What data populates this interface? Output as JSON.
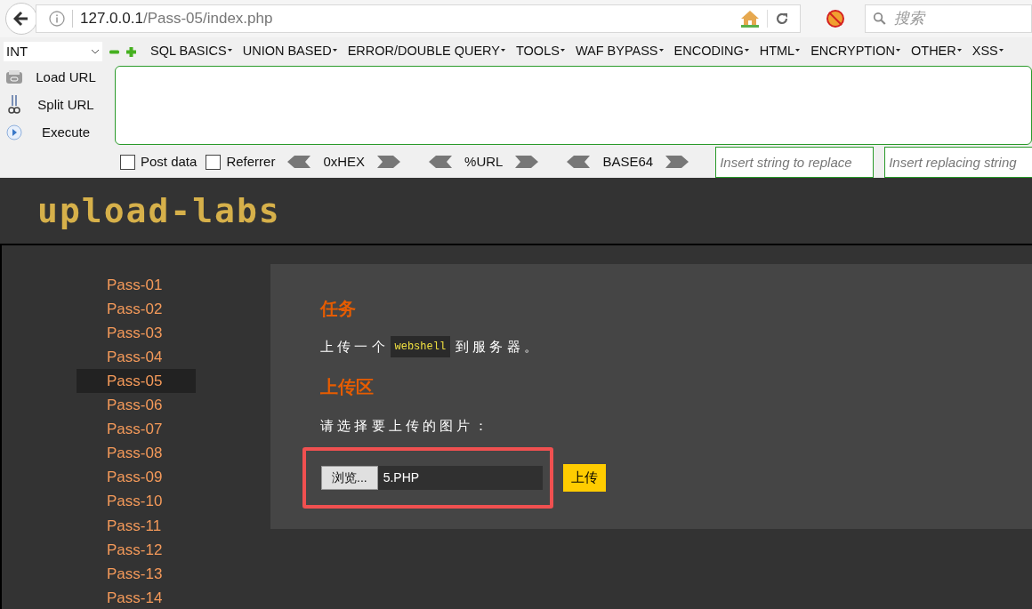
{
  "browser": {
    "url_host": "127.0.0.1",
    "url_path": "/Pass-05/index.php",
    "search_placeholder": "搜索"
  },
  "hackbar": {
    "select_value": "INT",
    "menus": [
      "SQL BASICS",
      "UNION BASED",
      "ERROR/DOUBLE QUERY",
      "TOOLS",
      "WAF BYPASS",
      "ENCODING",
      "HTML",
      "ENCRYPTION",
      "OTHER",
      "XSS"
    ],
    "actions": [
      {
        "kind": "load",
        "label": "Load URL"
      },
      {
        "kind": "split",
        "label": "Split URL"
      },
      {
        "kind": "execute",
        "label": "Execute"
      }
    ],
    "options": [
      {
        "label": "Post data",
        "checked": false
      },
      {
        "label": "Referrer",
        "checked": false
      }
    ],
    "encoders": [
      "0xHEX",
      "%URL",
      "BASE64"
    ],
    "replace_placeholders": [
      "Insert string to replace",
      "Insert replacing string"
    ]
  },
  "site": {
    "logo": "upload-labs",
    "nav": [
      {
        "label": "Pass-01",
        "selected": false
      },
      {
        "label": "Pass-02",
        "selected": false
      },
      {
        "label": "Pass-03",
        "selected": false
      },
      {
        "label": "Pass-04",
        "selected": false
      },
      {
        "label": "Pass-05",
        "selected": true
      },
      {
        "label": "Pass-06",
        "selected": false
      },
      {
        "label": "Pass-07",
        "selected": false
      },
      {
        "label": "Pass-08",
        "selected": false
      },
      {
        "label": "Pass-09",
        "selected": false
      },
      {
        "label": "Pass-10",
        "selected": false
      },
      {
        "label": "Pass-11",
        "selected": false
      },
      {
        "label": "Pass-12",
        "selected": false
      },
      {
        "label": "Pass-13",
        "selected": false
      },
      {
        "label": "Pass-14",
        "selected": false
      }
    ],
    "task_title": "任务",
    "task_before": "上 传 一 个",
    "task_code": "webshell",
    "task_after": "到 服 务 器 。",
    "upload_title": "上传区",
    "upload_prompt": "请 选 择 要 上 传 的 图 片 ：",
    "browse_label": "浏览...",
    "file_name": "5.PHP",
    "highlighted": true,
    "submit_label": "上传"
  }
}
